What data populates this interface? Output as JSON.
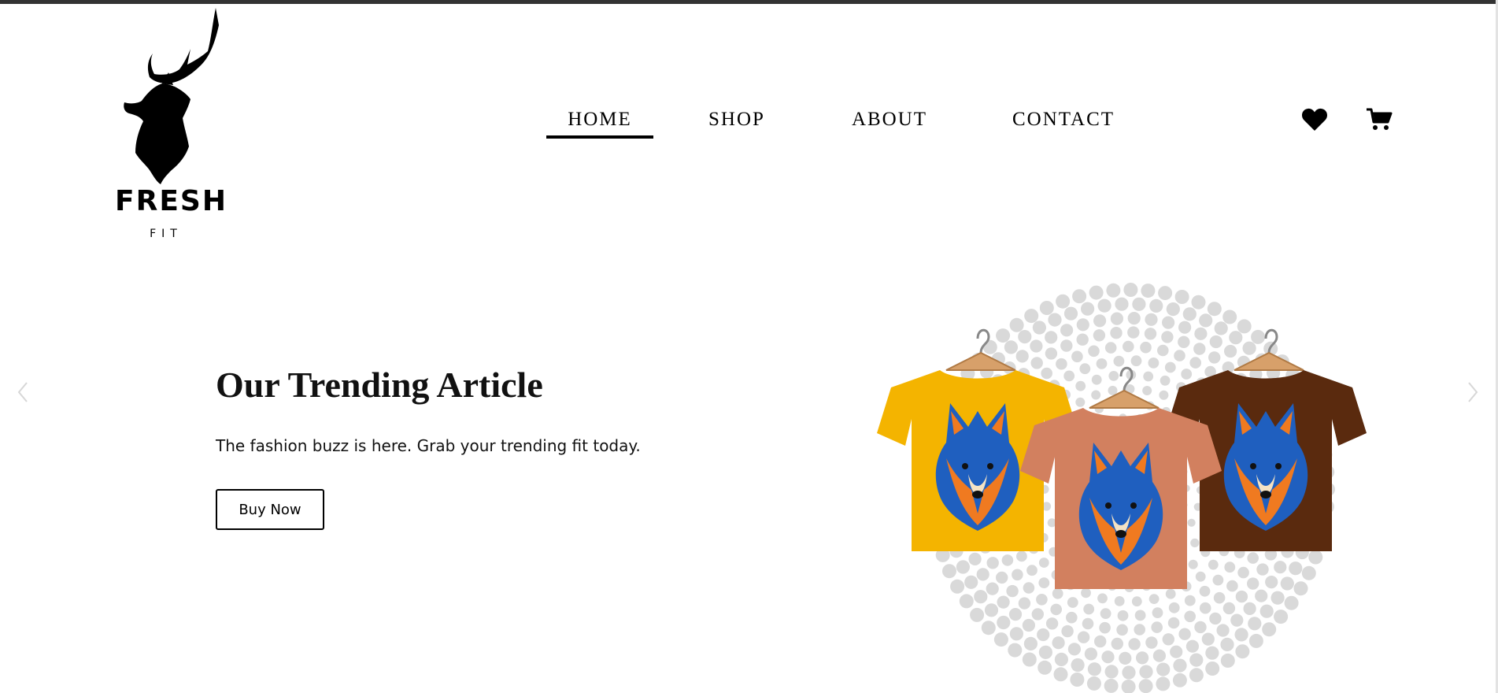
{
  "brand": {
    "name": "FRESH",
    "tagline": "FIT"
  },
  "nav": {
    "items": [
      {
        "label": "HOME",
        "active": true
      },
      {
        "label": "SHOP",
        "active": false
      },
      {
        "label": "ABOUT",
        "active": false
      },
      {
        "label": "CONTACT",
        "active": false
      }
    ]
  },
  "header_icons": [
    "heart-icon",
    "cart-icon"
  ],
  "hero": {
    "title": "Our Trending Article",
    "subtitle": "The fashion buzz is here. Grab your trending fit today.",
    "button_label": "Buy Now",
    "image_shirt_colors": [
      "#f4b400",
      "#d2805f",
      "#5a2a0e"
    ]
  },
  "slider": {
    "prev_icon": "chevron-left-icon",
    "next_icon": "chevron-right-icon"
  },
  "colors": {
    "text": "#111111",
    "background": "#ffffff",
    "dot_pattern": "#d9d9d9"
  }
}
